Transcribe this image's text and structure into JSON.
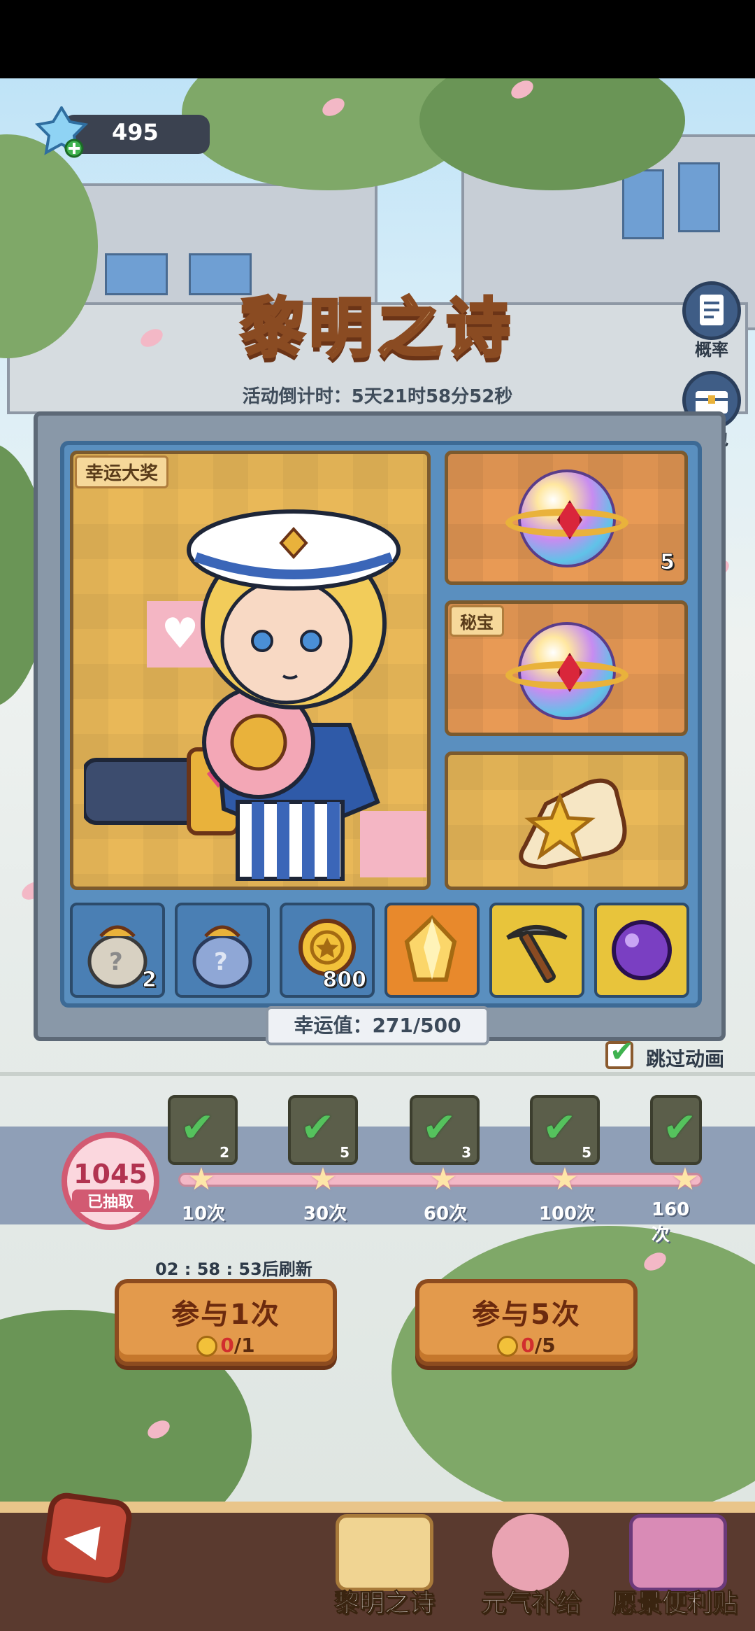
{
  "currency": {
    "value": "495",
    "icon": "crystal-plus-icon"
  },
  "title": "黎明之诗",
  "countdown": "活动倒计时：5天21时58分52秒",
  "side_buttons": [
    {
      "label": "概率",
      "icon": "document-icon"
    },
    {
      "label": "礼包",
      "icon": "chest-icon"
    }
  ],
  "grand_prize": {
    "tag": "幸运大奖",
    "character": "sailor-boy-character"
  },
  "prizes": [
    {
      "icon": "jeweled-orb-icon",
      "count": "5",
      "tag": ""
    },
    {
      "icon": "jeweled-orb-icon",
      "count": "",
      "tag": "秘宝"
    },
    {
      "icon": "star-scroll-icon",
      "count": "",
      "tag": ""
    }
  ],
  "slots": [
    {
      "icon": "mystery-bag-icon",
      "count": "2"
    },
    {
      "icon": "mystery-bag-blue-icon",
      "count": ""
    },
    {
      "icon": "gold-coin-icon",
      "count": "800"
    },
    {
      "icon": "crystal-icon",
      "count": ""
    },
    {
      "icon": "pickaxe-icon",
      "count": ""
    },
    {
      "icon": "purple-orb-icon",
      "count": ""
    }
  ],
  "luck": "幸运值：271/500",
  "skip_animation": {
    "label": "跳过动画",
    "checked": true
  },
  "drawn": {
    "count": "1045",
    "label": "已抽取"
  },
  "milestones": [
    {
      "label": "10次",
      "count": "2"
    },
    {
      "label": "30次",
      "count": "5"
    },
    {
      "label": "60次",
      "count": "3"
    },
    {
      "label": "100次",
      "count": "5"
    },
    {
      "label": "160次",
      "count": ""
    }
  ],
  "refresh": "02 : 58 : 53后刷新",
  "buttons": [
    {
      "title": "参与1次",
      "cost_zero": "0",
      "cost_total": "/1"
    },
    {
      "title": "参与5次",
      "cost_zero": "0",
      "cost_total": "/5"
    }
  ],
  "nav": {
    "back_icon": "back-arrow-icon",
    "tabs": [
      {
        "label": "黎明之诗",
        "active": true
      },
      {
        "label": "元气补给",
        "active": false
      },
      {
        "label": "愿景便利贴",
        "active": false
      }
    ]
  },
  "colors": {
    "accent": "#e39a4c",
    "board": "#5a8fbf",
    "progress": "#f3b8c6"
  }
}
